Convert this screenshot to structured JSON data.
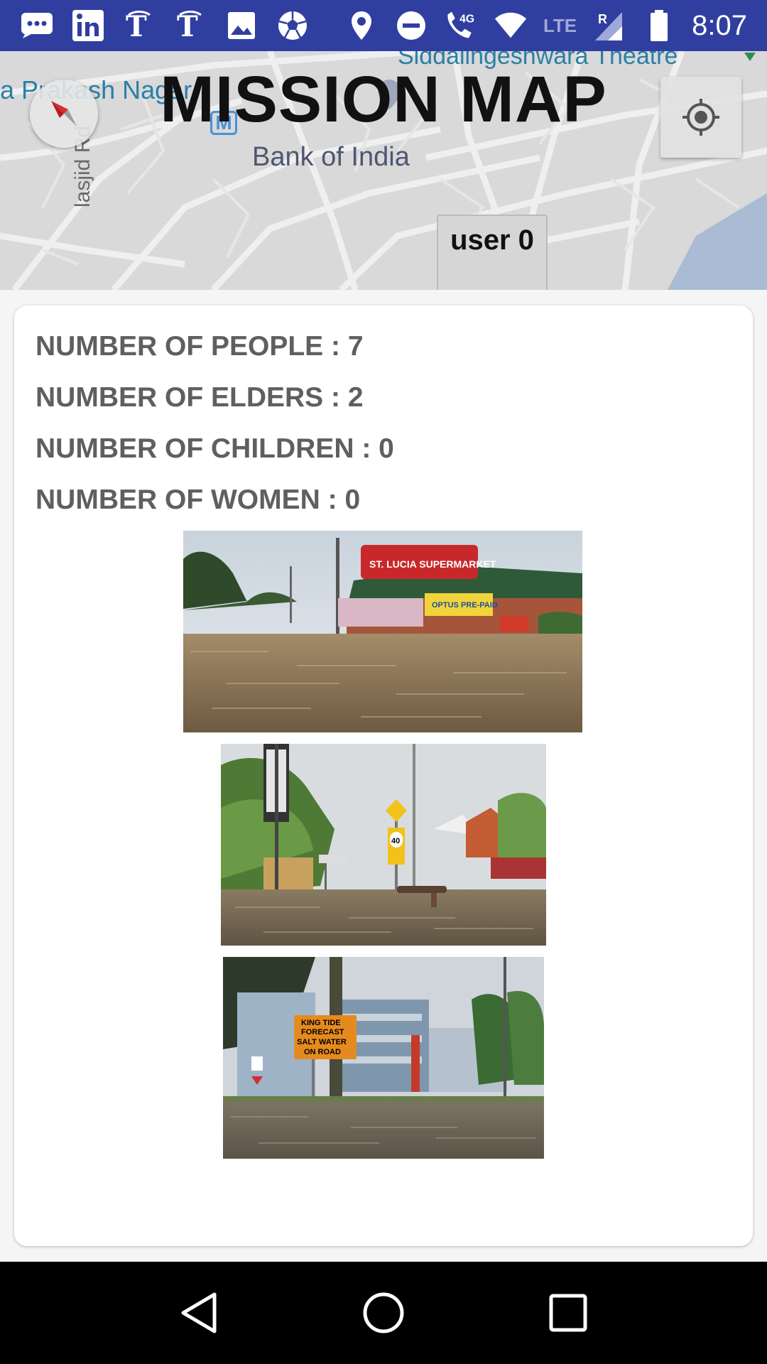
{
  "status_bar": {
    "time": "8:07",
    "network_label": "LTE",
    "roaming_label": "R",
    "data_label": "4G",
    "left_icons": [
      "messages-icon",
      "linkedin-icon",
      "nytimes-icon",
      "nytimes-icon",
      "gallery-icon",
      "soccer-ball-icon"
    ],
    "right_icons": [
      "location-icon",
      "do-not-disturb-icon",
      "wifi-calling-icon",
      "wifi-icon",
      "signal-icon",
      "battery-icon"
    ]
  },
  "map": {
    "title": "MISSION MAP",
    "area_label": "a Prakash Nagar",
    "bank_label": "Bank of India",
    "road_label": "lasjid Rd",
    "theatre_label": "Siddalingeshwara Theatre",
    "metro_label": "M",
    "user_button_label": "user 0"
  },
  "stats": {
    "people": "NUMBER OF PEOPLE : 7",
    "elders": "NUMBER OF ELDERS : 2",
    "children": "NUMBER OF CHILDREN : 0",
    "women": "NUMBER OF WOMEN : 0"
  },
  "photos": {
    "photo1_sign": "ST. LUCIA SUPERMARKET",
    "photo1_banner": "OPTUS PRE-PAID",
    "photo2_speed": "40",
    "photo3_sign_line1": "KING TIDE",
    "photo3_sign_line2": "FORECAST",
    "photo3_sign_line3": "SALT WATER",
    "photo3_sign_line4": "ON ROAD"
  },
  "colors": {
    "status_bar": "#303f9f",
    "map_bg": "#dcdcdc",
    "card_bg": "#ffffff",
    "stat_text": "#5f5f5f",
    "nav_bar": "#000000"
  },
  "nav": {
    "icons": [
      "back-icon",
      "home-icon",
      "recents-icon"
    ]
  }
}
